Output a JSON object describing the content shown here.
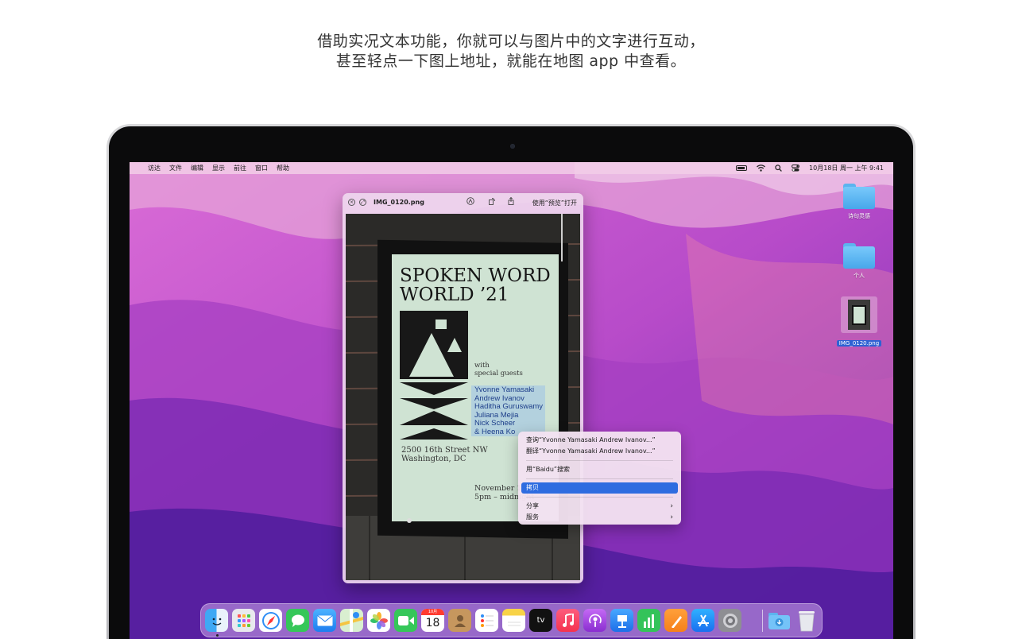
{
  "caption": {
    "line1": "借助实况文本功能，你就可以与图片中的文字进行互动，",
    "line2": "甚至轻点一下图上地址，就能在地图 app 中查看。"
  },
  "menubar": {
    "items": [
      "访达",
      "文件",
      "编辑",
      "显示",
      "前往",
      "窗口",
      "帮助"
    ],
    "clock": "10月18日 周一 上午 9:41",
    "status_icons": [
      "battery-icon",
      "wifi-icon",
      "search-icon",
      "control-center-icon"
    ]
  },
  "desktop": {
    "folders": [
      {
        "label": "诗句灵感"
      },
      {
        "label": "个人"
      }
    ],
    "file": {
      "label": "IMG_0120.png"
    }
  },
  "quicklook": {
    "title": "IMG_0120.png",
    "open_with": "使用“预览”打开",
    "poster": {
      "title_line1": "SPOKEN WORD",
      "title_line2": "WORLD ’21",
      "with": "with",
      "special_guests": "special guests",
      "guests": [
        "Yvonne Yamasaki",
        "Andrew Ivanov",
        "Haditha Guruswamy",
        "Juliana Mejia",
        "Nick Scheer",
        "& Heena Ko"
      ],
      "address_line1": "2500 16th Street NW",
      "address_line2": "Washington, DC",
      "date_line1": "November 10,",
      "date_line2": "5pm – midnight"
    }
  },
  "context_menu": {
    "items": [
      {
        "label": "查询“Yvonne Yamasaki Andrew Ivanov...”"
      },
      {
        "label": "翻译“Yvonne Yamasaki Andrew Ivanov...”"
      },
      {
        "label": "用“Baidu”搜索"
      },
      {
        "label": "拷贝"
      },
      {
        "label": "分享"
      },
      {
        "label": "服务"
      }
    ],
    "active_item": "拷贝"
  },
  "dock": {
    "apps": [
      "finder-icon",
      "launchpad-icon",
      "safari-icon",
      "messages-icon",
      "mail-icon",
      "maps-icon",
      "photos-icon",
      "facetime-icon",
      "calendar-icon",
      "contacts-icon",
      "reminders-icon",
      "notes-icon",
      "tv-icon",
      "music-icon",
      "podcasts-icon",
      "keynote-icon",
      "numbers-icon",
      "pages-icon",
      "app-store-icon",
      "system-preferences-icon",
      "downloads-folder-icon",
      "trash-icon"
    ],
    "calendar": {
      "month": "10月",
      "day": "18"
    },
    "tv_label": "tv"
  },
  "colors": {
    "accent": "#2e6ce0",
    "menubar": "#f2cde8",
    "poster_bg": "#cfe3d3"
  }
}
